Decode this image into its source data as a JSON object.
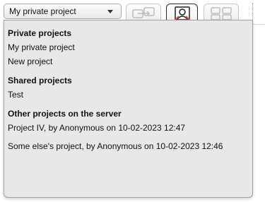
{
  "select": {
    "value": "My private project"
  },
  "toolbar": {
    "buttons": [
      {
        "icon": "swap-icon"
      },
      {
        "icon": "user-diagram-icon"
      },
      {
        "icon": "layout-icon"
      }
    ]
  },
  "menu": {
    "groups": [
      {
        "header": "Private projects",
        "items": [
          "My private project",
          "New project"
        ]
      },
      {
        "header": "Shared projects",
        "items": [
          "Test"
        ]
      },
      {
        "header": "Other projects on the server",
        "items": [
          "Project IV, by Anonymous on 10-02-2023 12:47",
          "Some else's project, by Anonymous on 10-02-2023 12:46"
        ]
      }
    ]
  },
  "colors": {
    "menu_bg": "#e8e8e8",
    "accent_red": "#d9534f"
  }
}
